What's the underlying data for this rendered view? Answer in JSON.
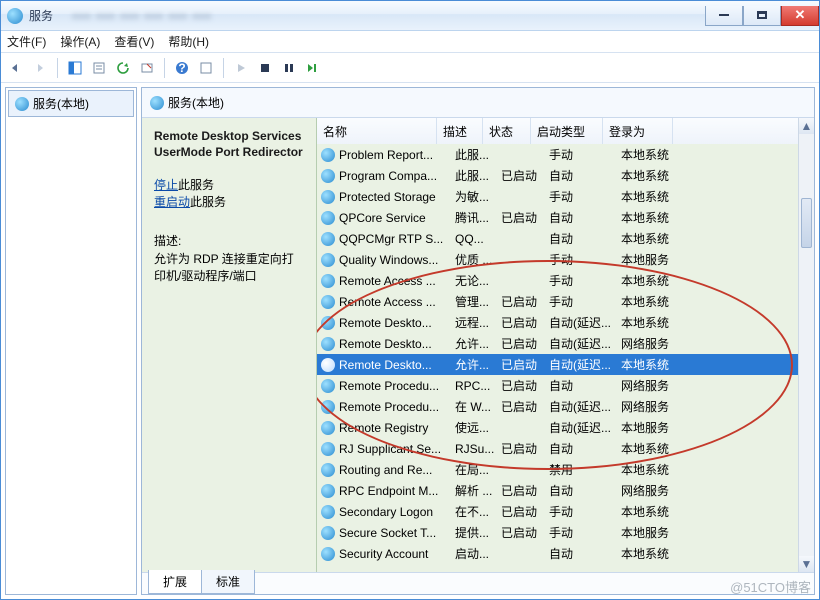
{
  "window": {
    "title": "服务"
  },
  "menubar": {
    "file": "文件(F)",
    "action": "操作(A)",
    "view": "查看(V)",
    "help": "帮助(H)"
  },
  "nav": {
    "local_services": "服务(本地)"
  },
  "content_header": "服务(本地)",
  "detail": {
    "service_name": "Remote Desktop Services UserMode Port Redirector",
    "stop_label": "停止",
    "stop_suffix": "此服务",
    "restart_label": "重启动",
    "restart_suffix": "此服务",
    "desc_label": "描述:",
    "desc_text": "允许为 RDP 连接重定向打印机/驱动程序/端口"
  },
  "columns": {
    "name": "名称",
    "desc": "描述",
    "status": "状态",
    "startup": "启动类型",
    "logon": "登录为"
  },
  "tabs": {
    "extended": "扩展",
    "standard": "标准"
  },
  "watermark": "@51CTO博客",
  "rows": [
    {
      "name": "Problem Report...",
      "desc": "此服...",
      "status": "",
      "start": "手动",
      "logon": "本地系统"
    },
    {
      "name": "Program Compa...",
      "desc": "此服...",
      "status": "已启动",
      "start": "自动",
      "logon": "本地系统"
    },
    {
      "name": "Protected Storage",
      "desc": "为敏...",
      "status": "",
      "start": "手动",
      "logon": "本地系统"
    },
    {
      "name": "QPCore Service",
      "desc": "腾讯...",
      "status": "已启动",
      "start": "自动",
      "logon": "本地系统"
    },
    {
      "name": "QQPCMgr RTP S...",
      "desc": "QQ...",
      "status": "",
      "start": "自动",
      "logon": "本地系统"
    },
    {
      "name": "Quality Windows...",
      "desc": "优质 ...",
      "status": "",
      "start": "手动",
      "logon": "本地服务"
    },
    {
      "name": "Remote Access ...",
      "desc": "无论...",
      "status": "",
      "start": "手动",
      "logon": "本地系统"
    },
    {
      "name": "Remote Access ...",
      "desc": "管理...",
      "status": "已启动",
      "start": "手动",
      "logon": "本地系统"
    },
    {
      "name": "Remote Deskto...",
      "desc": "远程...",
      "status": "已启动",
      "start": "自动(延迟...",
      "logon": "本地系统"
    },
    {
      "name": "Remote Deskto...",
      "desc": "允许...",
      "status": "已启动",
      "start": "自动(延迟...",
      "logon": "网络服务"
    },
    {
      "name": "Remote Deskto...",
      "desc": "允许...",
      "status": "已启动",
      "start": "自动(延迟...",
      "logon": "本地系统",
      "selected": true
    },
    {
      "name": "Remote Procedu...",
      "desc": "RPC...",
      "status": "已启动",
      "start": "自动",
      "logon": "网络服务"
    },
    {
      "name": "Remote Procedu...",
      "desc": "在 W...",
      "status": "已启动",
      "start": "自动(延迟...",
      "logon": "网络服务"
    },
    {
      "name": "Remote Registry",
      "desc": "使远...",
      "status": "",
      "start": "自动(延迟...",
      "logon": "本地服务"
    },
    {
      "name": "RJ Supplicant Se...",
      "desc": "RJSu...",
      "status": "已启动",
      "start": "自动",
      "logon": "本地系统"
    },
    {
      "name": "Routing and Re...",
      "desc": "在局...",
      "status": "",
      "start": "禁用",
      "logon": "本地系统"
    },
    {
      "name": "RPC Endpoint M...",
      "desc": "解析 ...",
      "status": "已启动",
      "start": "自动",
      "logon": "网络服务"
    },
    {
      "name": "Secondary Logon",
      "desc": "在不...",
      "status": "已启动",
      "start": "手动",
      "logon": "本地系统"
    },
    {
      "name": "Secure Socket T...",
      "desc": "提供...",
      "status": "已启动",
      "start": "手动",
      "logon": "本地服务"
    },
    {
      "name": "Security Account",
      "desc": "启动...",
      "status": "",
      "start": "自动",
      "logon": "本地系统"
    }
  ]
}
